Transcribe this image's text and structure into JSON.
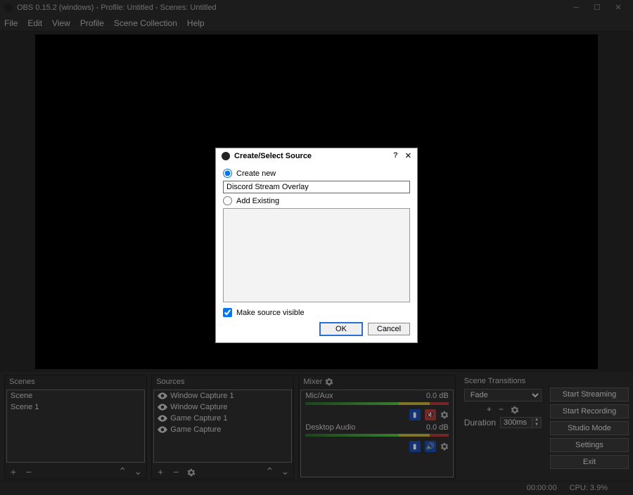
{
  "window": {
    "title": "OBS 0.15.2 (windows) - Profile: Untitled - Scenes: Untitled"
  },
  "menu": {
    "items": [
      "File",
      "Edit",
      "View",
      "Profile",
      "Scene Collection",
      "Help"
    ]
  },
  "panels": {
    "scenes": {
      "title": "Scenes",
      "items": [
        "Scene",
        "Scene 1"
      ]
    },
    "sources": {
      "title": "Sources",
      "items": [
        "Window Capture 1",
        "Window Capture",
        "Game Capture 1",
        "Game Capture"
      ]
    },
    "mixer": {
      "title": "Mixer",
      "channels": [
        {
          "name": "Mic/Aux",
          "level": "0.0 dB",
          "muted": true
        },
        {
          "name": "Desktop Audio",
          "level": "0.0 dB",
          "muted": false
        }
      ]
    },
    "transitions": {
      "title": "Scene Transitions",
      "selected": "Fade",
      "duration_label": "Duration",
      "duration_value": "300ms"
    }
  },
  "side_buttons": [
    "Start Streaming",
    "Start Recording",
    "Studio Mode",
    "Settings",
    "Exit"
  ],
  "statusbar": {
    "time": "00:00:00",
    "cpu": "CPU: 3.9%"
  },
  "dialog": {
    "title": "Create/Select Source",
    "create_new_label": "Create new",
    "add_existing_label": "Add Existing",
    "source_name": "Discord Stream Overlay",
    "make_visible_label": "Make source visible",
    "ok_label": "OK",
    "cancel_label": "Cancel",
    "help_glyph": "?",
    "close_glyph": "✕"
  }
}
